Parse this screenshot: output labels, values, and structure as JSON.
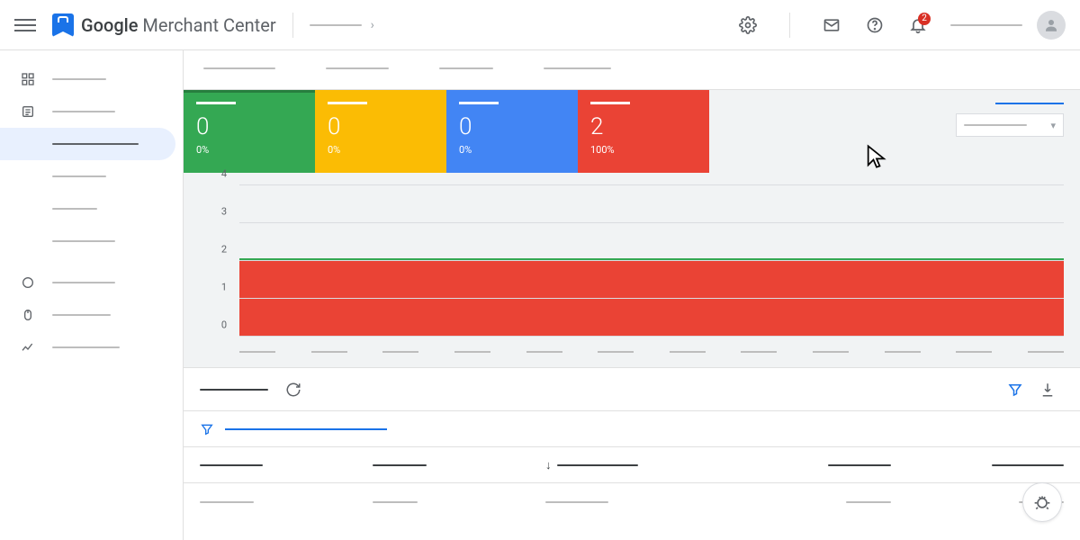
{
  "header": {
    "product_name_b": "Google",
    "product_name_l": " Merchant Center",
    "notification_count": "2"
  },
  "cards": [
    {
      "value": "0",
      "pct": "0%",
      "color": "green"
    },
    {
      "value": "0",
      "pct": "0%",
      "color": "orange"
    },
    {
      "value": "0",
      "pct": "0%",
      "color": "blue"
    },
    {
      "value": "2",
      "pct": "100%",
      "color": "red"
    }
  ],
  "chart_data": {
    "type": "bar",
    "ylim": [
      0,
      4
    ],
    "yticks": [
      "0",
      "1",
      "2",
      "3",
      "4"
    ],
    "x_tick_count": 12,
    "series": [
      {
        "name": "red",
        "value": 2,
        "color": "#ea4335"
      },
      {
        "name": "green",
        "value": 2,
        "color": "#34a853"
      }
    ]
  }
}
